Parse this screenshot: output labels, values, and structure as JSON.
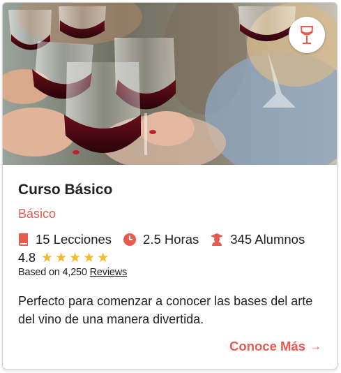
{
  "course": {
    "title": "Curso Básico",
    "level": "Básico",
    "lessons": "15 Lecciones",
    "duration": "2.5 Horas",
    "students": "345 Alumnos",
    "rating": "4.8",
    "stars": 5,
    "reviews_prefix": "Based on 4,250",
    "reviews_link": "Reviews",
    "description": "Perfecto para comenzar a conocer las bases del arte del vino de una manera divertida.",
    "cta_label": "Conoce Más",
    "cta_arrow": "→"
  },
  "icons": {
    "badge": "wine-glass-icon",
    "lessons": "book-icon",
    "duration": "clock-icon",
    "students": "student-icon",
    "cta": "arrow-right-icon"
  },
  "colors": {
    "accent": "#e85a4f",
    "star": "#f6b92b",
    "text": "#222222"
  }
}
